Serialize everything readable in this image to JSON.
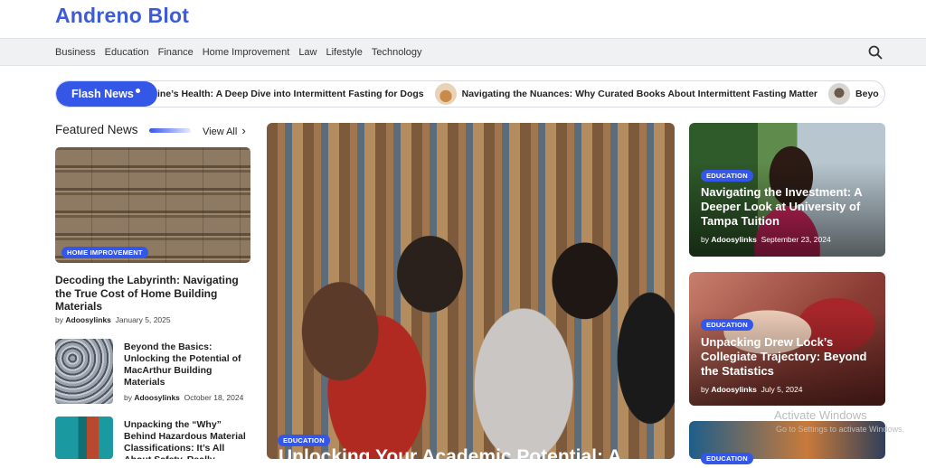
{
  "site": {
    "logo": "Andreno Blot"
  },
  "nav": {
    "items": [
      "Business",
      "Education",
      "Finance",
      "Home Improvement",
      "Law",
      "Lifestyle",
      "Technology"
    ]
  },
  "flash": {
    "label": "Flash News",
    "ticker": [
      "ine’s Health: A Deep Dive into Intermittent Fasting for Dogs",
      "Navigating the Nuances: Why Curated Books About Intermittent Fasting Matter",
      "Beyo"
    ]
  },
  "featured": {
    "heading": "Featured News",
    "view_all": "View All",
    "main": {
      "badge": "HOME IMPROVEMENT",
      "title": "Decoding the Labyrinth: Navigating the True Cost of Home Building Materials",
      "author": "Adoosylinks",
      "date": "January 5, 2025"
    },
    "list": [
      {
        "title": "Beyond the Basics: Unlocking the Potential of MacArthur Building Materials",
        "author": "Adoosylinks",
        "date": "October 18, 2024"
      },
      {
        "title": "Unpacking the “Why” Behind Hazardous Material Classifications: It’s All About Safety, Really",
        "author": "",
        "date": ""
      }
    ],
    "by": "by"
  },
  "hero": {
    "badge": "EDUCATION",
    "title": "Unlocking Your Academic Potential: A"
  },
  "side": [
    {
      "badge": "EDUCATION",
      "title": "Navigating the Investment: A Deeper Look at University of Tampa Tuition",
      "author": "Adoosylinks",
      "date": "September 23, 2024"
    },
    {
      "badge": "EDUCATION",
      "title": "Unpacking Drew Lock’s Collegiate Trajectory: Beyond the Statistics",
      "author": "Adoosylinks",
      "date": "July 5, 2024"
    },
    {
      "badge": "EDUCATION",
      "title": "",
      "author": "",
      "date": ""
    }
  ],
  "watermark": {
    "title": "Activate Windows",
    "sub": "Go to Settings to activate Windows."
  }
}
